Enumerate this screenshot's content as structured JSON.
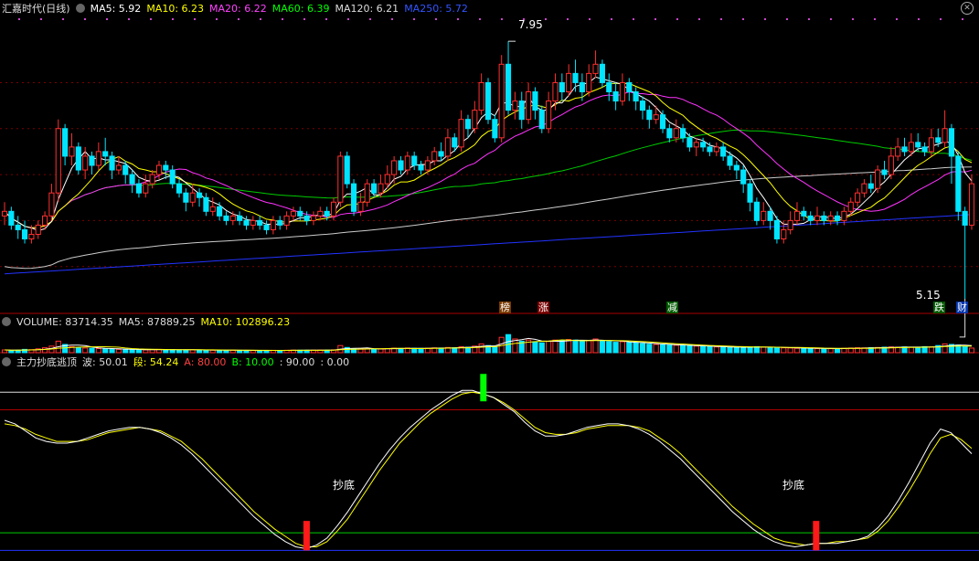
{
  "header": {
    "title": "汇嘉时代(日线)",
    "ma": [
      {
        "label": "MA5: 5.92",
        "color": "#ffffff"
      },
      {
        "label": "MA10: 6.23",
        "color": "#ffff00"
      },
      {
        "label": "MA20: 6.22",
        "color": "#ff44ff"
      },
      {
        "label": "MA60: 6.39",
        "color": "#00ff00"
      },
      {
        "label": "MA120: 6.21",
        "color": "#dddddd"
      },
      {
        "label": "MA250: 5.72",
        "color": "#3355ff"
      }
    ],
    "close_icon": "✕"
  },
  "volume_header": {
    "label": "VOLUME: 83714.35",
    "ma5": "MA5: 87889.25",
    "ma10": "MA10: 102896.23"
  },
  "indicator_header": {
    "name": "主力抄底逃顶",
    "wave": "波: 50.01",
    "seg": "段: 54.24",
    "a": "A: 80.00",
    "b": "B: 10.00",
    "c": ": 90.00",
    "d": ": 0.00"
  },
  "annotations": {
    "high": "7.95",
    "low": "5.15",
    "bottom_signal_1": "抄底",
    "bottom_signal_2": "抄底"
  },
  "event_tags": [
    {
      "text": "榜",
      "color": "#ff4040"
    },
    {
      "text": "涨",
      "color": "#ff4040"
    },
    {
      "text": "减",
      "color": "#00aa00"
    },
    {
      "text": "跌",
      "color": "#00aa00"
    },
    {
      "text": "财",
      "color": "#3366ff"
    }
  ],
  "colors": {
    "up": "#ff3030",
    "down": "#00e5ff",
    "grid": "#7a0000"
  },
  "chart_data": {
    "type": "candlestick",
    "ylim": [
      5.0,
      8.2
    ],
    "price_grid": [
      5.5,
      6.0,
      6.5,
      7.0,
      7.5
    ],
    "candles": [
      [
        6.05,
        6.1,
        6.2,
        5.95
      ],
      [
        6.1,
        5.95,
        6.15,
        5.9
      ],
      [
        5.95,
        5.9,
        6.05,
        5.8
      ],
      [
        5.9,
        5.8,
        6.0,
        5.75
      ],
      [
        5.8,
        5.85,
        5.95,
        5.75
      ],
      [
        5.85,
        5.95,
        6.0,
        5.8
      ],
      [
        5.95,
        6.05,
        6.1,
        5.9
      ],
      [
        6.05,
        6.3,
        6.4,
        6.0
      ],
      [
        6.3,
        7.0,
        7.1,
        6.2
      ],
      [
        7.0,
        6.7,
        7.05,
        6.6
      ],
      [
        6.7,
        6.8,
        6.95,
        6.6
      ],
      [
        6.8,
        6.55,
        6.85,
        6.5
      ],
      [
        6.55,
        6.7,
        6.8,
        6.45
      ],
      [
        6.7,
        6.6,
        6.75,
        6.5
      ],
      [
        6.6,
        6.75,
        6.85,
        6.55
      ],
      [
        6.75,
        6.7,
        6.9,
        6.6
      ],
      [
        6.7,
        6.55,
        6.75,
        6.45
      ],
      [
        6.55,
        6.6,
        6.7,
        6.5
      ],
      [
        6.6,
        6.5,
        6.65,
        6.4
      ],
      [
        6.5,
        6.4,
        6.55,
        6.3
      ],
      [
        6.4,
        6.3,
        6.45,
        6.25
      ],
      [
        6.3,
        6.4,
        6.5,
        6.25
      ],
      [
        6.4,
        6.5,
        6.55,
        6.35
      ],
      [
        6.5,
        6.6,
        6.65,
        6.45
      ],
      [
        6.6,
        6.55,
        6.65,
        6.45
      ],
      [
        6.55,
        6.4,
        6.6,
        6.35
      ],
      [
        6.4,
        6.3,
        6.45,
        6.25
      ],
      [
        6.3,
        6.2,
        6.35,
        6.1
      ],
      [
        6.2,
        6.3,
        6.4,
        6.15
      ],
      [
        6.3,
        6.25,
        6.35,
        6.15
      ],
      [
        6.25,
        6.1,
        6.3,
        6.05
      ],
      [
        6.1,
        6.15,
        6.25,
        6.05
      ],
      [
        6.15,
        6.05,
        6.2,
        6.0
      ],
      [
        6.05,
        6.0,
        6.1,
        5.95
      ],
      [
        6.0,
        6.05,
        6.1,
        5.95
      ],
      [
        6.05,
        6.0,
        6.1,
        5.95
      ],
      [
        6.0,
        5.95,
        6.05,
        5.9
      ],
      [
        5.95,
        6.0,
        6.05,
        5.9
      ],
      [
        6.0,
        5.95,
        6.05,
        5.9
      ],
      [
        5.95,
        5.9,
        6.0,
        5.85
      ],
      [
        5.9,
        6.0,
        6.05,
        5.85
      ],
      [
        6.0,
        5.95,
        6.05,
        5.9
      ],
      [
        5.95,
        6.05,
        6.1,
        5.9
      ],
      [
        6.05,
        6.1,
        6.15,
        6.0
      ],
      [
        6.1,
        6.05,
        6.15,
        6.0
      ],
      [
        6.05,
        6.0,
        6.1,
        5.95
      ],
      [
        6.0,
        6.05,
        6.1,
        5.95
      ],
      [
        6.05,
        6.1,
        6.15,
        6.0
      ],
      [
        6.1,
        6.05,
        6.15,
        6.0
      ],
      [
        6.05,
        6.2,
        6.25,
        6.0
      ],
      [
        6.2,
        6.7,
        6.75,
        6.15
      ],
      [
        6.7,
        6.4,
        6.75,
        6.35
      ],
      [
        6.4,
        6.1,
        6.45,
        6.05
      ],
      [
        6.1,
        6.2,
        6.3,
        6.05
      ],
      [
        6.2,
        6.4,
        6.45,
        6.15
      ],
      [
        6.4,
        6.3,
        6.45,
        6.25
      ],
      [
        6.3,
        6.4,
        6.5,
        6.25
      ],
      [
        6.4,
        6.5,
        6.6,
        6.35
      ],
      [
        6.5,
        6.65,
        6.7,
        6.4
      ],
      [
        6.65,
        6.55,
        6.7,
        6.5
      ],
      [
        6.55,
        6.7,
        6.75,
        6.5
      ],
      [
        6.7,
        6.6,
        6.75,
        6.55
      ],
      [
        6.6,
        6.55,
        6.65,
        6.5
      ],
      [
        6.55,
        6.65,
        6.7,
        6.5
      ],
      [
        6.65,
        6.75,
        6.8,
        6.6
      ],
      [
        6.75,
        6.7,
        6.85,
        6.65
      ],
      [
        6.7,
        6.9,
        7.0,
        6.65
      ],
      [
        6.9,
        6.8,
        6.95,
        6.75
      ],
      [
        6.8,
        7.1,
        7.2,
        6.75
      ],
      [
        7.1,
        7.0,
        7.15,
        6.9
      ],
      [
        7.0,
        7.2,
        7.3,
        6.95
      ],
      [
        7.2,
        7.5,
        7.6,
        7.15
      ],
      [
        7.5,
        7.1,
        7.55,
        7.05
      ],
      [
        7.1,
        6.9,
        7.15,
        6.85
      ],
      [
        6.9,
        7.7,
        7.8,
        6.85
      ],
      [
        7.7,
        7.2,
        7.95,
        7.15
      ],
      [
        7.2,
        7.3,
        7.4,
        7.1
      ],
      [
        7.3,
        7.1,
        7.4,
        7.0
      ],
      [
        7.1,
        7.4,
        7.5,
        7.05
      ],
      [
        7.4,
        7.2,
        7.45,
        7.1
      ],
      [
        7.2,
        7.0,
        7.25,
        6.95
      ],
      [
        7.0,
        7.3,
        7.4,
        6.95
      ],
      [
        7.3,
        7.5,
        7.6,
        7.2
      ],
      [
        7.5,
        7.4,
        7.6,
        7.3
      ],
      [
        7.4,
        7.6,
        7.7,
        7.35
      ],
      [
        7.6,
        7.5,
        7.75,
        7.4
      ],
      [
        7.5,
        7.4,
        7.6,
        7.3
      ],
      [
        7.4,
        7.6,
        7.7,
        7.35
      ],
      [
        7.6,
        7.7,
        7.85,
        7.55
      ],
      [
        7.7,
        7.5,
        7.75,
        7.45
      ],
      [
        7.5,
        7.4,
        7.6,
        7.3
      ],
      [
        7.4,
        7.3,
        7.5,
        7.2
      ],
      [
        7.3,
        7.5,
        7.6,
        7.25
      ],
      [
        7.5,
        7.4,
        7.55,
        7.3
      ],
      [
        7.4,
        7.3,
        7.45,
        7.2
      ],
      [
        7.3,
        7.2,
        7.35,
        7.1
      ],
      [
        7.2,
        7.1,
        7.25,
        7.0
      ],
      [
        7.1,
        7.15,
        7.25,
        7.05
      ],
      [
        7.15,
        7.0,
        7.2,
        6.95
      ],
      [
        7.0,
        6.9,
        7.05,
        6.85
      ],
      [
        6.9,
        7.0,
        7.1,
        6.85
      ],
      [
        7.0,
        6.9,
        7.05,
        6.85
      ],
      [
        6.9,
        6.8,
        6.95,
        6.75
      ],
      [
        6.8,
        6.85,
        6.9,
        6.7
      ],
      [
        6.85,
        6.8,
        6.9,
        6.75
      ],
      [
        6.8,
        6.75,
        6.85,
        6.7
      ],
      [
        6.75,
        6.8,
        6.85,
        6.7
      ],
      [
        6.8,
        6.7,
        6.85,
        6.65
      ],
      [
        6.7,
        6.6,
        6.75,
        6.55
      ],
      [
        6.6,
        6.55,
        6.65,
        6.45
      ],
      [
        6.55,
        6.4,
        6.6,
        6.3
      ],
      [
        6.4,
        6.2,
        6.45,
        6.1
      ],
      [
        6.2,
        6.0,
        6.25,
        5.95
      ],
      [
        6.0,
        6.1,
        6.2,
        5.95
      ],
      [
        6.1,
        6.0,
        6.15,
        5.9
      ],
      [
        6.0,
        5.8,
        6.05,
        5.75
      ],
      [
        5.8,
        5.9,
        6.0,
        5.75
      ],
      [
        5.9,
        6.0,
        6.1,
        5.85
      ],
      [
        6.0,
        6.1,
        6.2,
        5.95
      ],
      [
        6.1,
        6.05,
        6.15,
        6.0
      ],
      [
        6.05,
        6.0,
        6.1,
        5.95
      ],
      [
        6.0,
        6.05,
        6.15,
        5.95
      ],
      [
        6.05,
        6.0,
        6.1,
        5.95
      ],
      [
        6.0,
        6.05,
        6.1,
        5.95
      ],
      [
        6.05,
        6.0,
        6.1,
        5.95
      ],
      [
        6.0,
        6.1,
        6.15,
        5.95
      ],
      [
        6.1,
        6.2,
        6.25,
        6.05
      ],
      [
        6.2,
        6.3,
        6.35,
        6.15
      ],
      [
        6.3,
        6.4,
        6.45,
        6.25
      ],
      [
        6.4,
        6.35,
        6.5,
        6.3
      ],
      [
        6.35,
        6.55,
        6.6,
        6.3
      ],
      [
        6.55,
        6.5,
        6.65,
        6.45
      ],
      [
        6.5,
        6.7,
        6.8,
        6.45
      ],
      [
        6.7,
        6.8,
        6.9,
        6.65
      ],
      [
        6.8,
        6.75,
        6.9,
        6.7
      ],
      [
        6.75,
        6.85,
        6.95,
        6.7
      ],
      [
        6.85,
        6.8,
        6.95,
        6.75
      ],
      [
        6.8,
        6.75,
        6.85,
        6.7
      ],
      [
        6.75,
        6.9,
        7.0,
        6.7
      ],
      [
        6.9,
        6.85,
        7.0,
        6.8
      ],
      [
        6.85,
        7.0,
        7.2,
        6.8
      ],
      [
        7.0,
        6.7,
        7.05,
        6.4
      ],
      [
        6.7,
        6.1,
        6.75,
        6.0
      ],
      [
        6.1,
        5.95,
        6.15,
        5.15
      ],
      [
        5.95,
        6.4,
        6.5,
        5.9
      ]
    ],
    "volume": {
      "ylim": [
        0,
        400000
      ],
      "bars": [
        50000,
        40000,
        45000,
        60000,
        55000,
        70000,
        90000,
        120000,
        210000,
        150000,
        110000,
        90000,
        85000,
        80000,
        75000,
        70000,
        65000,
        60000,
        58000,
        55000,
        52000,
        50000,
        55000,
        60000,
        58000,
        55000,
        50000,
        48000,
        52000,
        50000,
        47000,
        45000,
        43000,
        42000,
        44000,
        43000,
        41000,
        40000,
        42000,
        41000,
        43000,
        42000,
        44000,
        46000,
        45000,
        44000,
        46000,
        48000,
        47000,
        52000,
        130000,
        95000,
        70000,
        65000,
        72000,
        68000,
        70000,
        75000,
        82000,
        78000,
        85000,
        80000,
        78000,
        82000,
        88000,
        85000,
        95000,
        90000,
        110000,
        100000,
        120000,
        160000,
        130000,
        110000,
        280000,
        330000,
        250000,
        210000,
        230000,
        200000,
        180000,
        210000,
        230000,
        220000,
        240000,
        230000,
        210000,
        225000,
        250000,
        220000,
        200000,
        190000,
        200000,
        185000,
        175000,
        165000,
        155000,
        150000,
        145000,
        140000,
        135000,
        130000,
        125000,
        120000,
        115000,
        110000,
        105000,
        100000,
        98000,
        95000,
        100000,
        105000,
        110000,
        100000,
        95000,
        90000,
        88000,
        85000,
        80000,
        78000,
        76000,
        74000,
        75000,
        73000,
        75000,
        80000,
        85000,
        90000,
        88000,
        92000,
        95000,
        100000,
        105000,
        100000,
        105000,
        100000,
        98000,
        110000,
        105000,
        130000,
        160000,
        150000,
        140000,
        110000,
        83714
      ]
    },
    "oscillator": {
      "ylim": [
        -5,
        100
      ],
      "levels": [
        80,
        90,
        10,
        0
      ],
      "wave": [
        74,
        72,
        68,
        64,
        62,
        61,
        61,
        62,
        64,
        66,
        68,
        69,
        70,
        70,
        69,
        67,
        64,
        60,
        55,
        49,
        43,
        37,
        31,
        25,
        19,
        14,
        9,
        5,
        2,
        1,
        3,
        7,
        14,
        22,
        31,
        40,
        49,
        57,
        64,
        70,
        75,
        80,
        84,
        88,
        91,
        91,
        89,
        87,
        83,
        79,
        73,
        68,
        65,
        65,
        66,
        68,
        70,
        71,
        72,
        72,
        71,
        69,
        66,
        62,
        57,
        52,
        46,
        40,
        34,
        28,
        22,
        17,
        12,
        8,
        5,
        3,
        2,
        3,
        4,
        4,
        4,
        5,
        6,
        8,
        13,
        20,
        29,
        39,
        50,
        61,
        69,
        67,
        61,
        55
      ],
      "segment": [
        72,
        71,
        69,
        66,
        64,
        62,
        62,
        62,
        63,
        65,
        67,
        68,
        69,
        70,
        69,
        68,
        65,
        62,
        57,
        52,
        46,
        40,
        34,
        28,
        22,
        17,
        12,
        8,
        4,
        2,
        2,
        5,
        11,
        18,
        27,
        36,
        45,
        53,
        61,
        67,
        73,
        78,
        82,
        86,
        89,
        90,
        89,
        87,
        84,
        80,
        75,
        70,
        67,
        66,
        66,
        67,
        69,
        70,
        71,
        71,
        71,
        70,
        68,
        64,
        60,
        55,
        49,
        43,
        37,
        31,
        25,
        20,
        15,
        11,
        7,
        5,
        4,
        3,
        4,
        4,
        5,
        5,
        6,
        7,
        11,
        17,
        25,
        34,
        44,
        55,
        64,
        66,
        63,
        58
      ],
      "bottom_signals": [
        29,
        78
      ],
      "top_signal": 46
    }
  }
}
